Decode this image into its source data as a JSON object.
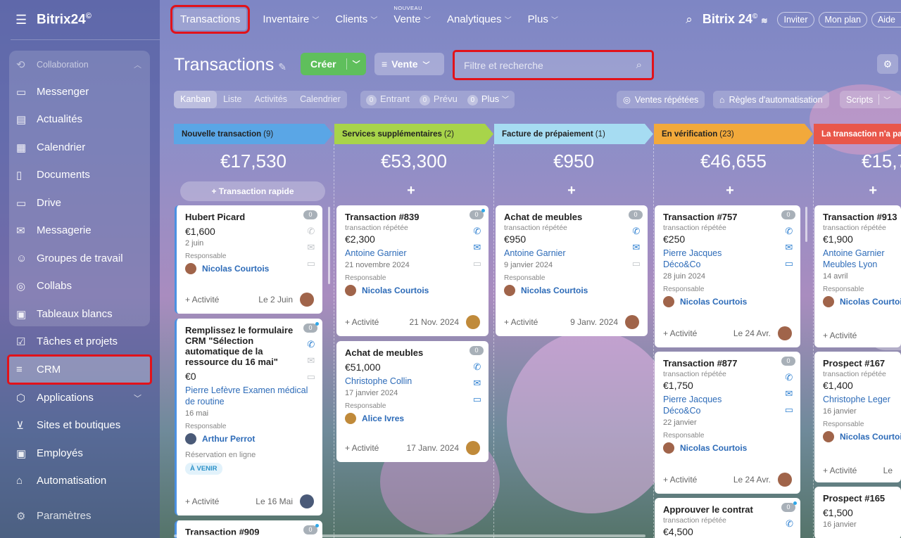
{
  "sidebar": {
    "logo": "Bitrix24",
    "logo_mark": "©",
    "items": [
      {
        "label": "Collaboration",
        "icon": "collab-icon"
      },
      {
        "label": "Messenger",
        "icon": "chat-icon"
      },
      {
        "label": "Actualités",
        "icon": "news-icon"
      },
      {
        "label": "Calendrier",
        "icon": "calendar-icon"
      },
      {
        "label": "Documents",
        "icon": "document-icon"
      },
      {
        "label": "Drive",
        "icon": "drive-icon"
      },
      {
        "label": "Messagerie",
        "icon": "mail-icon"
      },
      {
        "label": "Groupes de travail",
        "icon": "groups-icon"
      },
      {
        "label": "Collabs",
        "icon": "collabs-icon"
      },
      {
        "label": "Tableaux blancs",
        "icon": "whiteboard-icon"
      },
      {
        "label": "Tâches et projets",
        "icon": "tasks-icon"
      },
      {
        "label": "CRM",
        "icon": "crm-icon"
      },
      {
        "label": "Applications",
        "icon": "apps-icon"
      },
      {
        "label": "Sites et boutiques",
        "icon": "cart-icon"
      },
      {
        "label": "Employés",
        "icon": "employees-icon"
      },
      {
        "label": "Automatisation",
        "icon": "robot-icon"
      },
      {
        "label": "Paramètres",
        "icon": "gear-icon"
      }
    ]
  },
  "topbar": {
    "tabs": [
      "Transactions",
      "Inventaire",
      "Clients",
      "Vente",
      "Analytiques",
      "Plus"
    ],
    "new_label": "NOUVEAU",
    "brand": "Bitrix 24",
    "invite": "Inviter",
    "plan": "Mon plan",
    "help": "Aide"
  },
  "toolbar": {
    "title": "Transactions",
    "create": "Créer",
    "vente": "Vente",
    "search_placeholder": "Filtre et recherche"
  },
  "views": {
    "items": [
      "Kanban",
      "Liste",
      "Activités",
      "Calendrier"
    ],
    "counters": [
      {
        "n": "0",
        "label": "Entrant"
      },
      {
        "n": "0",
        "label": "Prévu"
      },
      {
        "n": "0",
        "label": "Plus"
      }
    ],
    "repeat": "Ventes répétées",
    "automation": "Règles d'automatisation",
    "scripts": "Scripts"
  },
  "columns": [
    {
      "title": "Nouvelle transaction",
      "count": "(9)",
      "sum": "€17,530",
      "color": "#5aa6e6",
      "quick": "+ Transaction rapide"
    },
    {
      "title": "Services supplémentaires",
      "count": "(2)",
      "sum": "€53,300",
      "color": "#a8d44a"
    },
    {
      "title": "Facture de prépaiement",
      "count": "(1)",
      "sum": "€950",
      "color": "#a6dcf2"
    },
    {
      "title": "En vérification",
      "count": "(23)",
      "sum": "€46,655",
      "color": "#f2a93b"
    },
    {
      "title": "La transaction n'a pa",
      "count": "",
      "sum": "€15,7",
      "color": "#e9574a"
    }
  ],
  "cards": {
    "c1": {
      "name": "Hubert Picard",
      "amount": "€1,600",
      "date": "2 juin",
      "resp_label": "Responsable",
      "resp": "Nicolas Courtois",
      "act": "+ Activité",
      "fdate": "Le 2 Juin",
      "badge": "0"
    },
    "c2": {
      "name": "Remplissez le formulaire CRM \"Sélection automatique de la ressource du 16 mai\"",
      "amount": "€0",
      "link": "Pierre Lefèvre Examen médical de routine",
      "date": "16 mai",
      "resp_label": "Responsable",
      "resp": "Arthur Perrot",
      "extra": "Réservation en ligne",
      "tag": "À VENIR",
      "act": "+ Activité",
      "fdate": "Le 16 Mai",
      "badge": "0"
    },
    "c3": {
      "name": "Transaction #909",
      "badge": "0"
    },
    "c4": {
      "name": "Transaction #839",
      "sub": "transaction répétée",
      "amount": "€2,300",
      "link": "Antoine Garnier",
      "date": "21 novembre 2024",
      "resp_label": "Responsable",
      "resp": "Nicolas Courtois",
      "act": "+ Activité",
      "fdate": "21 Nov. 2024",
      "badge": "0"
    },
    "c5": {
      "name": "Achat de meubles",
      "amount": "€51,000",
      "link": "Christophe Collin",
      "date": "17 janvier 2024",
      "resp_label": "Responsable",
      "resp": "Alice Ivres",
      "act": "+ Activité",
      "fdate": "17 Janv. 2024",
      "badge": "0"
    },
    "c6": {
      "name": "Achat de meubles",
      "sub": "transaction répétée",
      "amount": "€950",
      "link": "Antoine Garnier",
      "date": "9 janvier 2024",
      "resp_label": "Responsable",
      "resp": "Nicolas Courtois",
      "act": "+ Activité",
      "fdate": "9 Janv. 2024",
      "badge": "0"
    },
    "c7": {
      "name": "Transaction #757",
      "sub": "transaction répétée",
      "amount": "€250",
      "link": "Pierre Jacques Déco&Co",
      "date": "28 juin 2024",
      "resp_label": "Responsable",
      "resp": "Nicolas Courtois",
      "act": "+ Activité",
      "fdate": "Le 24 Avr.",
      "badge": "0"
    },
    "c8": {
      "name": "Transaction #877",
      "sub": "transaction répétée",
      "amount": "€1,750",
      "link": "Pierre Jacques Déco&Co",
      "date": "22 janvier",
      "resp_label": "Responsable",
      "resp": "Nicolas Courtois",
      "act": "+ Activité",
      "fdate": "Le 24 Avr.",
      "badge": "0"
    },
    "c9": {
      "name": "Approuver le contrat",
      "sub": "transaction répétée",
      "amount": "€4,500",
      "badge": "0"
    },
    "c10": {
      "name": "Transaction #913",
      "sub": "transaction répétée",
      "amount": "€1,900",
      "link": "Antoine Garnier Meubles Lyon",
      "date": "14 avril",
      "resp_label": "Responsable",
      "resp": "Nicolas Courtois",
      "act": "+ Activité"
    },
    "c11": {
      "name": "Prospect #167",
      "sub": "transaction répétée",
      "amount": "€1,400",
      "link": "Christophe Leger",
      "date": "16 janvier",
      "resp_label": "Responsable",
      "resp": "Nicolas Courtois",
      "act": "+ Activité",
      "fdate": "Le"
    },
    "c12": {
      "name": "Prospect #165",
      "amount": "€1,500",
      "date": "16 janvier"
    }
  }
}
